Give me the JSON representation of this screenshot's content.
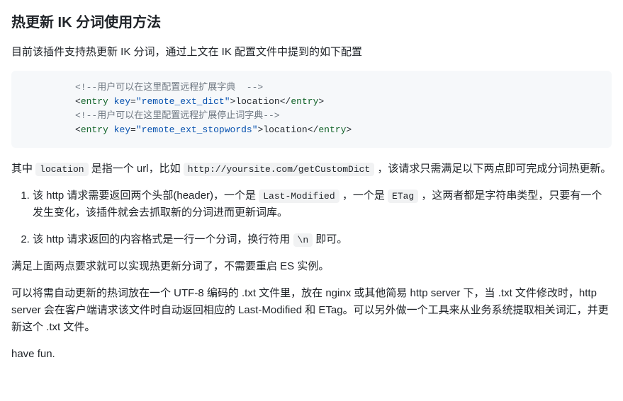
{
  "heading": "热更新 IK 分词使用方法",
  "intro": "目前该插件支持热更新 IK 分词，通过上文在 IK 配置文件中提到的如下配置",
  "code": {
    "comment1": "<!--用户可以在这里配置远程扩展字典  -->",
    "tag_open": "<",
    "tag_close": ">",
    "tag_end": "</",
    "entry": "entry",
    "key_attr": "key",
    "eq": "=",
    "q": "\"",
    "key1": "remote_ext_dict",
    "val1": "location",
    "comment2": "<!--用户可以在这里配置远程扩展停止词字典-->",
    "key2": "remote_ext_stopwords",
    "val2": "location"
  },
  "p1": {
    "a": "其中 ",
    "loc": "location",
    "b": " 是指一个 url，比如 ",
    "url": "http://yoursite.com/getCustomDict",
    "c": " ，该请求只需满足以下两点即可完成分词热更新。"
  },
  "list": {
    "i1": {
      "a": "该 http 请求需要返回两个头部(header)，一个是 ",
      "lm": "Last-Modified",
      "b": " ，一个是 ",
      "et": "ETag",
      "c": " ，这两者都是字符串类型，只要有一个发生变化，该插件就会去抓取新的分词进而更新词库。"
    },
    "i2": {
      "a": "该 http 请求返回的内容格式是一行一个分词，换行符用 ",
      "nl": "\\n",
      "b": " 即可。"
    }
  },
  "p2": "满足上面两点要求就可以实现热更新分词了，不需要重启 ES 实例。",
  "p3": "可以将需自动更新的热词放在一个 UTF-8 编码的 .txt 文件里，放在 nginx 或其他简易 http server 下，当 .txt 文件修改时，http server 会在客户端请求该文件时自动返回相应的 Last-Modified 和 ETag。可以另外做一个工具来从业务系统提取相关词汇，并更新这个 .txt 文件。",
  "p4": "have fun."
}
